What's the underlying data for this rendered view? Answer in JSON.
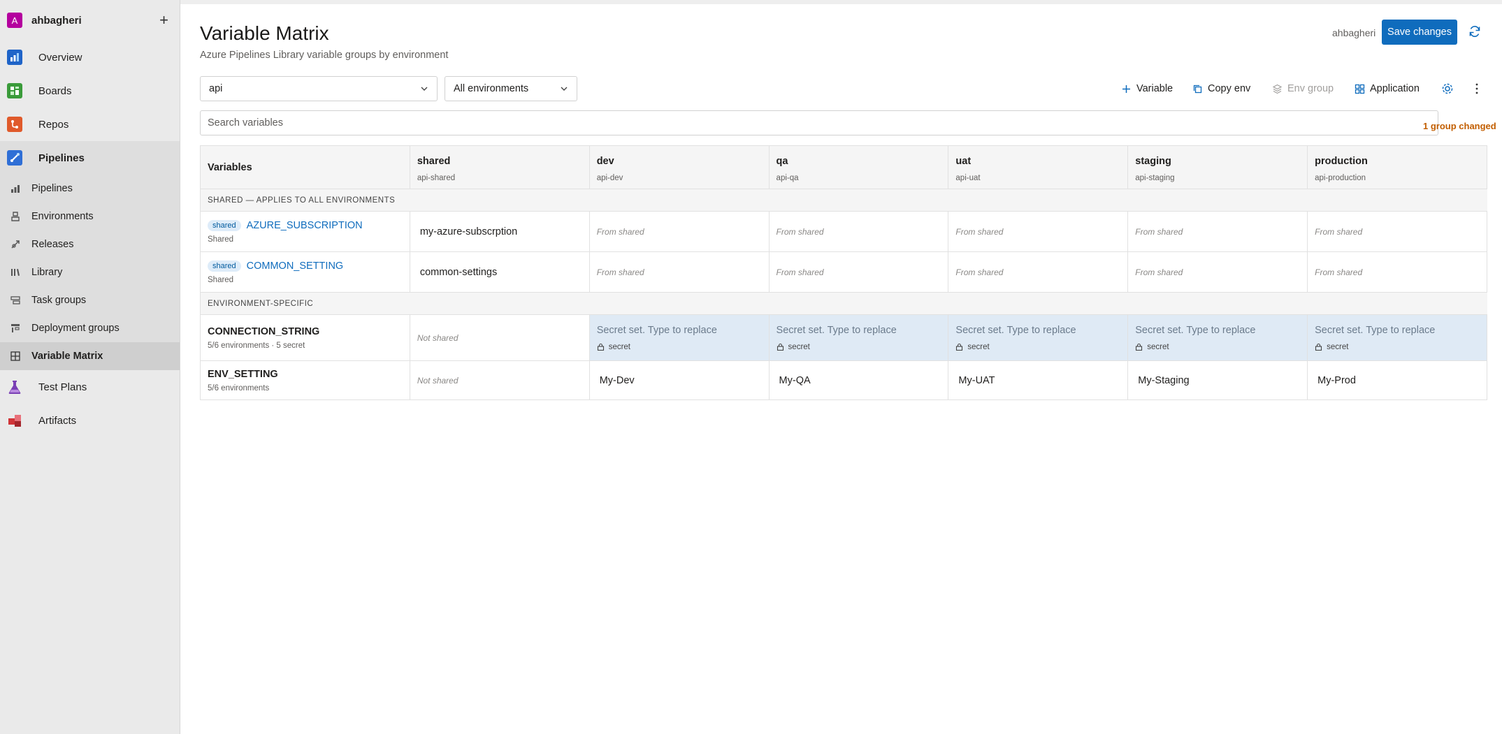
{
  "sidebar": {
    "org": {
      "avatar_letter": "A",
      "name": "ahbagheri",
      "add_icon": "plus-icon"
    },
    "items": [
      {
        "label": "Overview",
        "icon": "overview-icon",
        "color": "#1f64c8"
      },
      {
        "label": "Boards",
        "icon": "boards-icon",
        "color": "#3a9b3a"
      },
      {
        "label": "Repos",
        "icon": "repos-icon",
        "color": "#e05a2b"
      }
    ],
    "pipelines": {
      "label": "Pipelines",
      "icon": "pipelines-icon",
      "color": "#2f6fd6",
      "subitems": [
        {
          "label": "Pipelines",
          "icon": "pipeline-icon"
        },
        {
          "label": "Environments",
          "icon": "environments-icon"
        },
        {
          "label": "Releases",
          "icon": "releases-icon"
        },
        {
          "label": "Library",
          "icon": "library-icon"
        },
        {
          "label": "Task groups",
          "icon": "task-groups-icon"
        },
        {
          "label": "Deployment groups",
          "icon": "deployment-groups-icon"
        },
        {
          "label": "Variable Matrix",
          "icon": "grid-icon",
          "active": true
        }
      ]
    },
    "bottom_items": [
      {
        "label": "Test Plans",
        "icon": "test-plans-icon",
        "color": "#7a3fb5"
      },
      {
        "label": "Artifacts",
        "icon": "artifacts-icon",
        "color": "#d13438"
      }
    ]
  },
  "header": {
    "title": "Variable Matrix",
    "subtitle": "Azure Pipelines Library variable groups by environment",
    "user": "ahbagheri",
    "save_label": "Save changes"
  },
  "filters": {
    "application": "api",
    "environment": "All environments"
  },
  "toolbar": {
    "add_variable": "Variable",
    "copy_env": "Copy env",
    "env_group": "Env group",
    "application": "Application"
  },
  "search": {
    "placeholder": "Search variables",
    "changed_text": "1 group changed"
  },
  "colors": {
    "accent": "#0f6cbd",
    "changed": "#c25e00",
    "secret_bg": "#dfeaf5"
  },
  "table": {
    "header_label": "Variables",
    "columns": [
      {
        "name": "shared",
        "group": "api-shared"
      },
      {
        "name": "dev",
        "group": "api-dev"
      },
      {
        "name": "qa",
        "group": "api-qa"
      },
      {
        "name": "uat",
        "group": "api-uat"
      },
      {
        "name": "staging",
        "group": "api-staging"
      },
      {
        "name": "production",
        "group": "api-production"
      }
    ],
    "section_shared": "SHARED — APPLIES TO ALL ENVIRONMENTS",
    "section_env": "ENVIRONMENT-SPECIFIC",
    "shared_rows": [
      {
        "badge": "shared",
        "name": "AZURE_SUBSCRIPTION",
        "sub": "Shared",
        "value": "my-azure-subscrption",
        "inherited": "From shared"
      },
      {
        "badge": "shared",
        "name": "COMMON_SETTING",
        "sub": "Shared",
        "value": "common-settings",
        "inherited": "From shared"
      }
    ],
    "env_rows": [
      {
        "name": "CONNECTION_STRING",
        "sub": "5/6 environments · 5 secret",
        "shared": "Not shared",
        "secret_placeholder": "Secret set. Type to replace",
        "secret_label": "secret"
      },
      {
        "name": "ENV_SETTING",
        "sub": "5/6 environments",
        "shared": "Not shared",
        "values": [
          "My-Dev",
          "My-QA",
          "My-UAT",
          "My-Staging",
          "My-Prod"
        ]
      }
    ]
  }
}
